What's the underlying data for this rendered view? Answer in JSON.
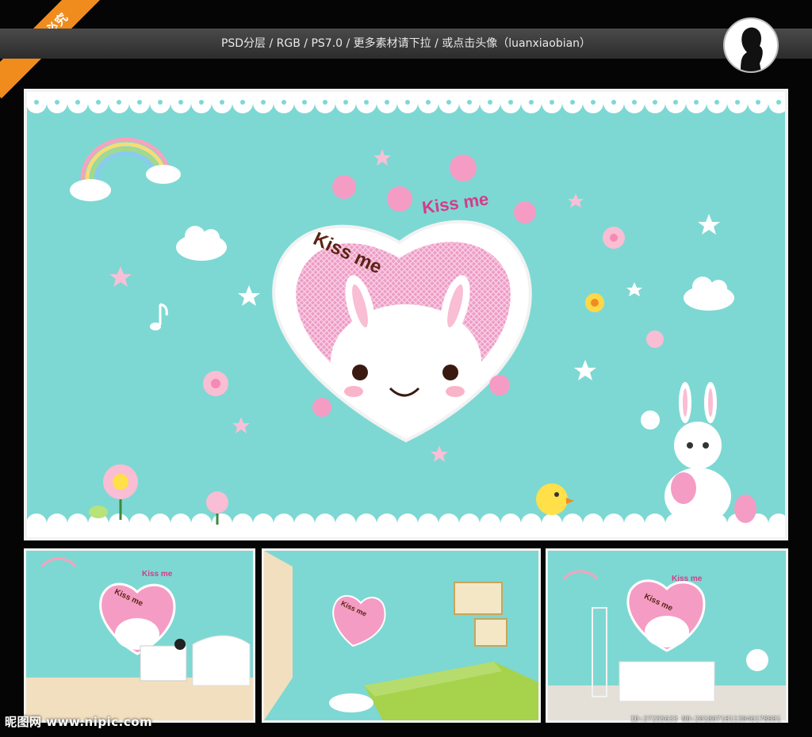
{
  "banner": {
    "ribbon": "转载•必究",
    "info": "PSD分层 / RGB / PS7.0 / 更多素材请下拉 / 或点击头像（luanxiaobian）"
  },
  "artwork": {
    "kiss_me_top": "Kiss me",
    "kiss_me_heart": "Kiss me"
  },
  "thumbnails": [
    {
      "kiss_me_top": "Kiss me",
      "kiss_me_heart": "Kiss me"
    },
    {
      "kiss_me_heart": "Kiss me"
    },
    {
      "kiss_me_top": "Kiss me",
      "kiss_me_heart": "Kiss me"
    }
  ],
  "watermark": {
    "site": "昵图网 www.nipic.com",
    "id": "ID:27255633 NO:20180718113046178081"
  },
  "colors": {
    "wall": "#7dd8d3",
    "heart_pink": "#e586b4",
    "accent_orange": "#f08c1e"
  }
}
